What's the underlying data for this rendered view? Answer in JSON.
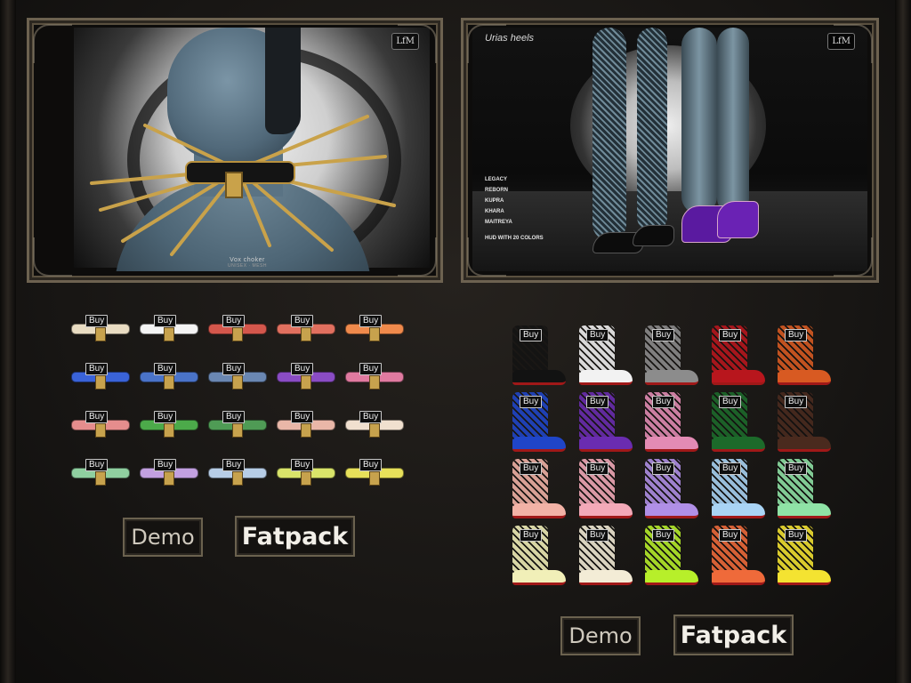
{
  "choker_ad": {
    "brand": "LfM",
    "caption": "Vox choker",
    "caption_sub": "UNISEX · MESH"
  },
  "heels_ad": {
    "title": "Urias heels",
    "brand": "LfM",
    "bodies": [
      "LEGACY",
      "REBORN",
      "KUPRA",
      "KHARA",
      "MAITREYA"
    ],
    "hud_note": "HUD WITH 20 COLORS"
  },
  "buy_label": "Buy",
  "choker_colors": [
    [
      "#e9dcc2",
      "#f4f4f4",
      "#d4574c",
      "#e1705f",
      "#f08a4c"
    ],
    [
      "#3a63d8",
      "#4a73c8",
      "#6a87b2",
      "#8a4cc4",
      "#e07aa0"
    ],
    [
      "#e58d8d",
      "#4caa4a",
      "#4f9b55",
      "#e9b7a8",
      "#f0e0cf"
    ],
    [
      "#8fcfa0",
      "#c2a0e0",
      "#b7cde6",
      "#d9e46a",
      "#e7e05a"
    ]
  ],
  "heel_colors": [
    [
      "#121212",
      "#f2f2f2",
      "#8c8c8c",
      "#b8161d",
      "#d85a22"
    ],
    [
      "#1f45c8",
      "#6a2cb0",
      "#e38bb4",
      "#1c6a2a",
      "#4a2a1e"
    ],
    [
      "#f2b2a6",
      "#f3a9b8",
      "#b08fe6",
      "#a9d4f5",
      "#8fe3a6"
    ],
    [
      "#f1efb8",
      "#f3ecd6",
      "#b7ef2a",
      "#ef6a3a",
      "#f4e331"
    ]
  ],
  "chokers_buttons": {
    "demo": "Demo",
    "fatpack": "Fatpack"
  },
  "heels_buttons": {
    "demo": "Demo",
    "fatpack": "Fatpack"
  }
}
